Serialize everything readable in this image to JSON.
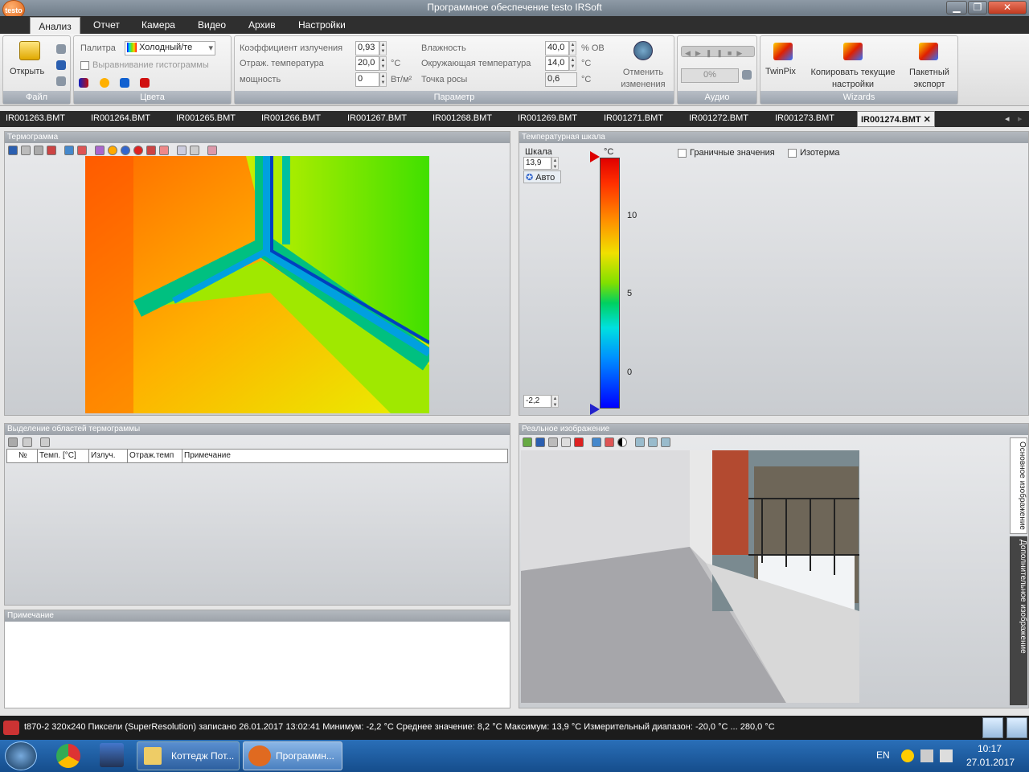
{
  "window": {
    "title": "Программное обеспечение testo IRSoft",
    "logo": "testo",
    "minimize": "▁",
    "maximize": "❐",
    "close": "✕"
  },
  "menu": {
    "tabs": [
      "Анализ",
      "Отчет",
      "Камера",
      "Видео",
      "Архив",
      "Настройки"
    ]
  },
  "ribbon": {
    "file": {
      "open": "Открыть",
      "caption": "Файл"
    },
    "colors": {
      "palette_label": "Палитра",
      "palette_value": "Холодный/те",
      "histogram": "Выравнивание гистограммы",
      "caption": "Цвета"
    },
    "params": {
      "emissivity_label": "Коэффициент излучения",
      "emissivity": "0,93",
      "refl_label": "Отраж. температура",
      "refl": "20,0",
      "refl_unit": "°C",
      "power_label": "мощность",
      "power": "0",
      "power_unit": "Вт/м²",
      "humidity_label": "Влажность",
      "humidity": "40,0",
      "humidity_unit": "% ОВ",
      "ambient_label": "Окружающая температура",
      "ambient": "14,0",
      "ambient_unit": "°C",
      "dew_label": "Точка росы",
      "dew": "0,6",
      "dew_unit": "°C",
      "undo": "Отменить изменения",
      "caption": "Параметр"
    },
    "audio": {
      "progress": "0%",
      "caption": "Аудио"
    },
    "wizards": {
      "twinpix": "TwinPix",
      "copy": "Копировать текущие настройки",
      "batch": "Пакетный экспорт",
      "caption": "Wizards"
    }
  },
  "files": [
    "IR001263.BMT",
    "IR001264.BMT",
    "IR001265.BMT",
    "IR001266.BMT",
    "IR001267.BMT",
    "IR001268.BMT",
    "IR001269.BMT",
    "IR001271.BMT",
    "IR001272.BMT",
    "IR001273.BMT"
  ],
  "active_file": "IR001274.BMT",
  "file_close": "✕",
  "panels": {
    "thermogram": "Термограмма",
    "scale": "Температурная шкала",
    "regions": "Выделение областей термограммы",
    "note": "Примечание",
    "real": "Реальное изображение"
  },
  "scale": {
    "label": "Шкала",
    "max": "13,9",
    "auto": "Авто",
    "min": "-2,2",
    "unit": "°C",
    "ticks": [
      "10",
      "5",
      "0"
    ],
    "boundary": "Граничные значения",
    "isotherm": "Изотерма"
  },
  "table": {
    "cols": [
      "№",
      "Темп. [°C]",
      "Излуч.",
      "Отраж.темп",
      "Примечание"
    ]
  },
  "side_tabs": [
    "Основное изображение",
    "Дополнительное изображение"
  ],
  "status": "t870-2  320x240  Пиксели  (SuperResolution)  записано  26.01.2017  13:02:41  Минимум:  -2,2 °C  Среднее значение:  8,2 °C  Максимум:  13,9 °C  Измерительный диапазон: -20,0 °C ... 280,0 °C",
  "taskbar": {
    "item1": "Коттедж Пот...",
    "item2": "Программн...",
    "lang": "EN",
    "time": "10:17",
    "date": "27.01.2017"
  }
}
